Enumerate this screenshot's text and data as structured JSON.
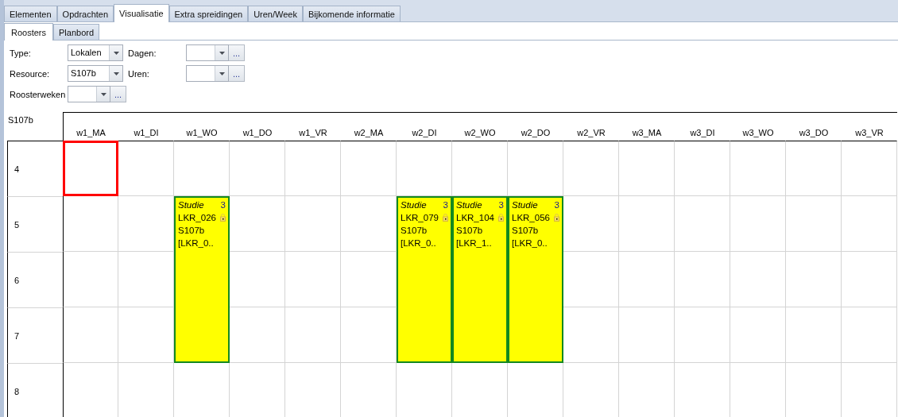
{
  "tabs": [
    {
      "label": "Elementen",
      "selected": false
    },
    {
      "label": "Opdrachten",
      "selected": false
    },
    {
      "label": "Visualisatie",
      "selected": true
    },
    {
      "label": "Extra spreidingen",
      "selected": false
    },
    {
      "label": "Uren/Week",
      "selected": false
    },
    {
      "label": "Bijkomende informatie",
      "selected": false
    }
  ],
  "subtabs": [
    {
      "label": "Roosters",
      "selected": true
    },
    {
      "label": "Planbord",
      "selected": false
    }
  ],
  "filters": [
    {
      "fields": [
        {
          "label": "Type:",
          "kind": "combo",
          "value": "Lokalen"
        },
        {
          "label": "Dagen:",
          "kind": "combo-browse",
          "browse": "..."
        }
      ]
    },
    {
      "fields": [
        {
          "label": "Resource:",
          "kind": "combo",
          "value": "S107b"
        },
        {
          "label": "Uren:",
          "kind": "combo-browse",
          "browse": "..."
        }
      ]
    },
    {
      "fields": [
        {
          "label": "Roosterweken",
          "kind": "combo-browse",
          "browse": "..."
        }
      ]
    }
  ],
  "grid": {
    "resource": "S107b",
    "columns": [
      "w1_MA",
      "w1_DI",
      "w1_WO",
      "w1_DO",
      "w1_VR",
      "w2_MA",
      "w2_DI",
      "w2_WO",
      "w2_DO",
      "w2_VR",
      "w3_MA",
      "w3_DI",
      "w3_WO",
      "w3_DO",
      "w3_VR"
    ],
    "rows": [
      {
        "label": "4",
        "cells": [
          {
            "kind": "slot",
            "selected": true
          },
          {
            "kind": "slot",
            "selected": false
          },
          {
            "kind": "slot",
            "selected": false
          },
          {
            "kind": "slot",
            "selected": false
          },
          {
            "kind": "slot",
            "selected": false
          },
          {
            "kind": "slot",
            "selected": false
          },
          {
            "kind": "slot",
            "selected": false
          },
          {
            "kind": "slot",
            "selected": false
          },
          {
            "kind": "slot",
            "selected": false
          },
          {
            "kind": "slot",
            "selected": false
          },
          {
            "kind": "slot",
            "selected": false
          },
          {
            "kind": "slot",
            "selected": false
          },
          {
            "kind": "slot",
            "selected": false
          },
          {
            "kind": "slot",
            "selected": false
          },
          {
            "kind": "slot",
            "selected": false
          }
        ]
      },
      {
        "label": "5",
        "cells": [
          {
            "kind": "slot",
            "selected": false
          },
          {
            "kind": "slot",
            "selected": false
          },
          {
            "kind": "slot",
            "selected": false,
            "event": {
              "title": "Studie",
              "count": "3",
              "code": "LKR_026",
              "room": "S107b",
              "note": "[LKR_0..",
              "locked": true
            }
          },
          {
            "kind": "slot",
            "selected": false
          },
          {
            "kind": "slot",
            "selected": false
          },
          {
            "kind": "slot",
            "selected": false
          },
          {
            "kind": "slot",
            "selected": false,
            "event": {
              "title": "Studie",
              "count": "3",
              "code": "LKR_079",
              "room": "S107b",
              "note": "[LKR_0..",
              "locked": true
            }
          },
          {
            "kind": "slot",
            "selected": false,
            "event": {
              "title": "Studie",
              "count": "3",
              "code": "LKR_104",
              "room": "S107b",
              "note": "[LKR_1..",
              "locked": true
            }
          },
          {
            "kind": "slot",
            "selected": false,
            "event": {
              "title": "Studie",
              "count": "3",
              "code": "LKR_056",
              "room": "S107b",
              "note": "[LKR_0..",
              "locked": true
            }
          },
          {
            "kind": "slot",
            "selected": false
          },
          {
            "kind": "slot",
            "selected": false
          },
          {
            "kind": "slot",
            "selected": false
          },
          {
            "kind": "slot",
            "selected": false
          },
          {
            "kind": "slot",
            "selected": false
          },
          {
            "kind": "slot",
            "selected": false
          }
        ]
      },
      {
        "label": "6",
        "cells": [
          {
            "kind": "slot",
            "selected": false
          },
          {
            "kind": "slot",
            "selected": false
          },
          {
            "kind": "continued"
          },
          {
            "kind": "slot",
            "selected": false
          },
          {
            "kind": "slot",
            "selected": false
          },
          {
            "kind": "slot",
            "selected": false
          },
          {
            "kind": "continued"
          },
          {
            "kind": "continued"
          },
          {
            "kind": "continued"
          },
          {
            "kind": "slot",
            "selected": false
          },
          {
            "kind": "slot",
            "selected": false
          },
          {
            "kind": "slot",
            "selected": false
          },
          {
            "kind": "slot",
            "selected": false
          },
          {
            "kind": "slot",
            "selected": false
          },
          {
            "kind": "slot",
            "selected": false
          }
        ]
      },
      {
        "label": "7",
        "cells": [
          {
            "kind": "slot",
            "selected": false
          },
          {
            "kind": "slot",
            "selected": false
          },
          {
            "kind": "continued"
          },
          {
            "kind": "slot",
            "selected": false
          },
          {
            "kind": "slot",
            "selected": false
          },
          {
            "kind": "slot",
            "selected": false
          },
          {
            "kind": "continued"
          },
          {
            "kind": "continued"
          },
          {
            "kind": "continued"
          },
          {
            "kind": "slot",
            "selected": false
          },
          {
            "kind": "slot",
            "selected": false
          },
          {
            "kind": "slot",
            "selected": false
          },
          {
            "kind": "slot",
            "selected": false
          },
          {
            "kind": "slot",
            "selected": false
          },
          {
            "kind": "slot",
            "selected": false
          }
        ]
      },
      {
        "label": "8",
        "cells": [
          {
            "kind": "slot",
            "selected": false
          },
          {
            "kind": "slot",
            "selected": false
          },
          {
            "kind": "slot",
            "selected": false
          },
          {
            "kind": "slot",
            "selected": false
          },
          {
            "kind": "slot",
            "selected": false
          },
          {
            "kind": "slot",
            "selected": false
          },
          {
            "kind": "slot",
            "selected": false
          },
          {
            "kind": "slot",
            "selected": false
          },
          {
            "kind": "slot",
            "selected": false
          },
          {
            "kind": "slot",
            "selected": false
          },
          {
            "kind": "slot",
            "selected": false
          },
          {
            "kind": "slot",
            "selected": false
          },
          {
            "kind": "slot",
            "selected": false
          },
          {
            "kind": "slot",
            "selected": false
          },
          {
            "kind": "slot",
            "selected": false
          }
        ]
      }
    ]
  }
}
